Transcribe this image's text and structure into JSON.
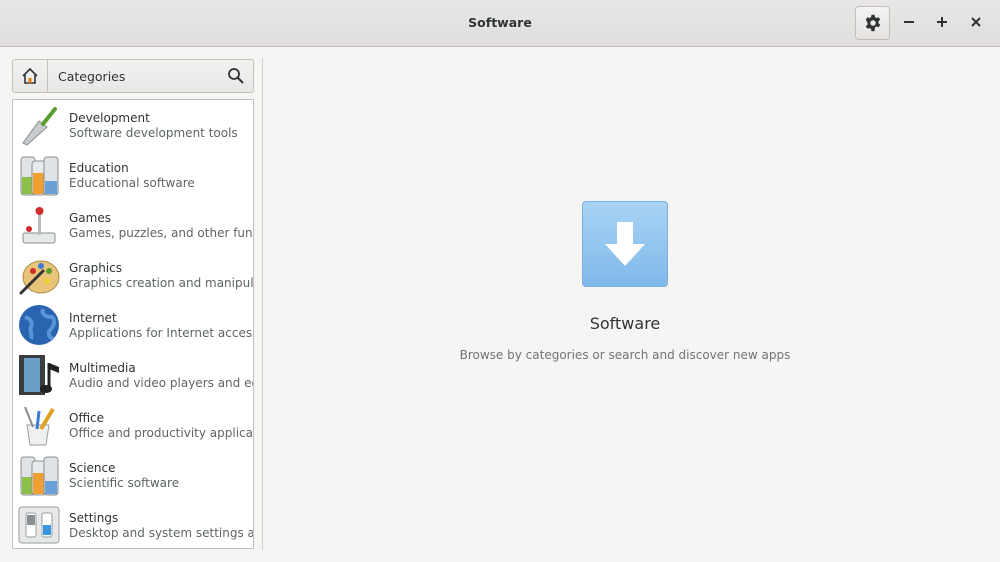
{
  "window": {
    "title": "Software",
    "controls": {
      "minimize": "−",
      "maximize": "+",
      "close": "×"
    }
  },
  "sidebar": {
    "header_label": "Categories",
    "items": [
      {
        "name": "Development",
        "desc": "Software development tools",
        "icon": "trowel-icon"
      },
      {
        "name": "Education",
        "desc": "Educational software",
        "icon": "flasks-icon"
      },
      {
        "name": "Games",
        "desc": "Games, puzzles, and other fun software",
        "icon": "joystick-icon"
      },
      {
        "name": "Graphics",
        "desc": "Graphics creation and manipulation applications",
        "icon": "palette-icon"
      },
      {
        "name": "Internet",
        "desc": "Applications for Internet access",
        "icon": "globe-icon"
      },
      {
        "name": "Multimedia",
        "desc": "Audio and video players and editors",
        "icon": "film-music-icon"
      },
      {
        "name": "Office",
        "desc": "Office and productivity applications",
        "icon": "pencil-cup-icon"
      },
      {
        "name": "Science",
        "desc": "Scientific software",
        "icon": "flasks-icon"
      },
      {
        "name": "Settings",
        "desc": "Desktop and system settings applications",
        "icon": "switches-icon"
      }
    ]
  },
  "main": {
    "title": "Software",
    "subtitle": "Browse by categories or search and discover new apps"
  },
  "colors": {
    "accent": "#7fb9ea",
    "background": "#f6f5f4",
    "titlebar": "#e3e2e1"
  }
}
